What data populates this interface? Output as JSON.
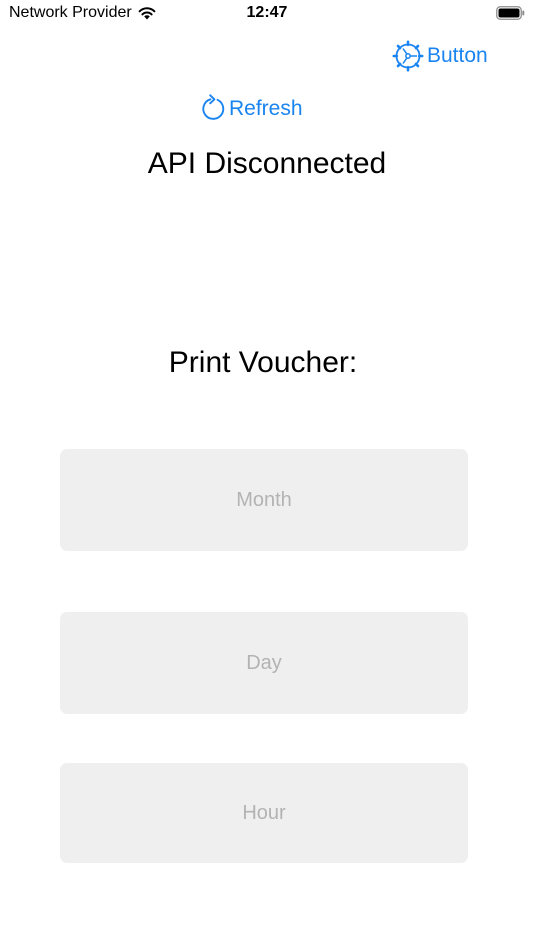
{
  "status_bar": {
    "carrier": "Network Provider",
    "time": "12:47"
  },
  "header": {
    "settings_label": "Button",
    "refresh_label": "Refresh"
  },
  "api": {
    "status_text": "API Disconnected"
  },
  "voucher": {
    "title": "Print Voucher:",
    "options": {
      "month": "Month",
      "day": "Day",
      "hour": "Hour"
    }
  },
  "colors": {
    "accent": "#1a84f0",
    "button_bg": "#efefef",
    "button_text": "#b3b3b3"
  },
  "icons": {
    "status": [
      "wifi-icon",
      "battery-icon"
    ],
    "settings": "gear-icon",
    "refresh": "refresh-icon"
  }
}
